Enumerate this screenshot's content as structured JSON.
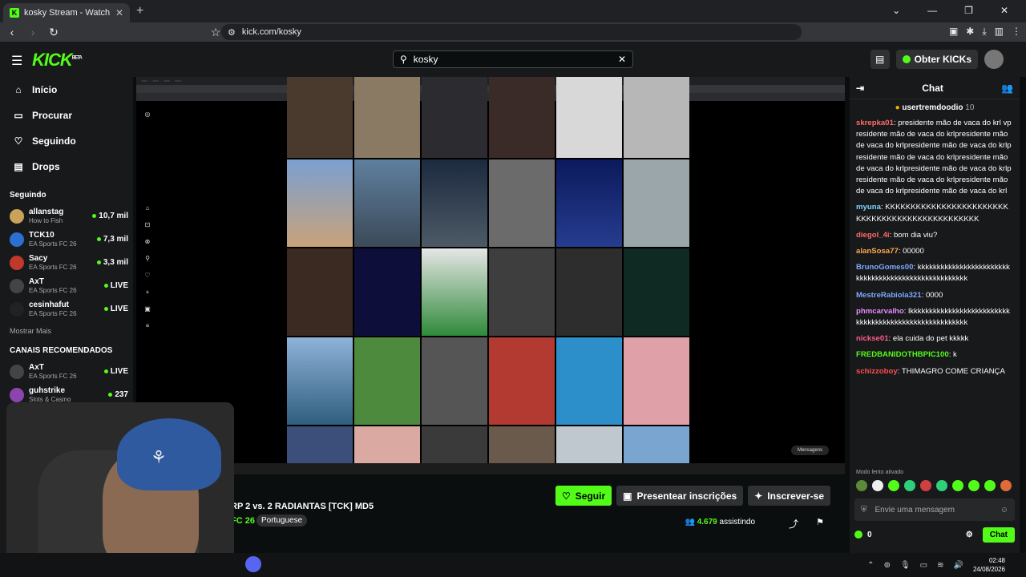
{
  "browser": {
    "tab_title": "kosky Stream - Watch Live on Ki",
    "url": "kick.com/kosky"
  },
  "header": {
    "logo": "KICK",
    "logo_tag": "BETA",
    "search_value": "kosky",
    "kicks_label": "Obter KICKs"
  },
  "sidebar": {
    "nav": [
      {
        "label": "Início",
        "icon": "home-icon"
      },
      {
        "label": "Procurar",
        "icon": "browse-icon"
      },
      {
        "label": "Seguindo",
        "icon": "heart-icon"
      },
      {
        "label": "Drops",
        "icon": "drops-icon"
      }
    ],
    "following_title": "Seguindo",
    "following": [
      {
        "name": "allanstag",
        "category": "How to Fish",
        "viewers": "10,7 mil",
        "color": "#c9a25b"
      },
      {
        "name": "TCK10",
        "category": "EA Sports FC 26",
        "viewers": "7,3 mil",
        "color": "#2c6fd0"
      },
      {
        "name": "Sacy",
        "category": "EA Sports FC 26",
        "viewers": "3,3 mil",
        "color": "#c0392b"
      },
      {
        "name": "AxT",
        "category": "EA Sports FC 26",
        "viewers": "LIVE",
        "color": "#444"
      },
      {
        "name": "cesinhafut",
        "category": "EA Sports FC 26",
        "viewers": "LIVE",
        "color": "#222"
      }
    ],
    "show_more": "Mostrar Mais",
    "recommended_title": "CANAIS RECOMENDADOS",
    "recommended": [
      {
        "name": "AxT",
        "category": "EA Sports FC 26",
        "viewers": "LIVE",
        "color": "#444"
      },
      {
        "name": "guhstrike",
        "category": "Slots & Casino",
        "viewers": "237",
        "color": "#8e44ad"
      }
    ]
  },
  "stream": {
    "title": "RP 2 vs. 2 RADIANTAS [TCK] MD5",
    "category": "FC 26",
    "language": "Portuguese",
    "follow_label": "Seguir",
    "gift_label": "Presentear inscrições",
    "subscribe_label": "Inscrever-se",
    "viewers": "4.679",
    "viewers_suffix": "assistindo"
  },
  "video_overlay": {
    "messages_label": "Mensagens"
  },
  "chat": {
    "title": "Chat",
    "pinned_user": "usertremdoodio",
    "pinned_count": "10",
    "messages": [
      {
        "user": "skrepka01",
        "color": "#ff6b6b",
        "text": "presidente mão de vaca do krl vpresidente mão de vaca do krlpresidente mão de vaca do krlpresidente mão de vaca do krlpresidente mão de vaca do krlpresidente mão de vaca do krlpresidente mão de vaca do krlpresidente mão de vaca do krlpresidente mão de vaca do krlpresidente mão de vaca do krl"
      },
      {
        "user": "myuna",
        "color": "#7fd3ff",
        "text": "KKKKKKKKKKKKKKKKKKKKKKKKKKKKKKKKKKKKKKKKKKKKKKKK"
      },
      {
        "user": "diegol_4i",
        "color": "#ff6b6b",
        "text": "bom dia viu?"
      },
      {
        "user": "alanSosa77",
        "color": "#ffa94d",
        "text": "00000"
      },
      {
        "user": "BrunoGomes00",
        "color": "#7fa8ff",
        "text": "kkkkkkkkkkkkkkkkkkkkkkkkkkkkkkkkkkkkkkkkkkkkkkkkkkkkk"
      },
      {
        "user": "MestreRabiola321",
        "color": "#7fa8ff",
        "text": "0000"
      },
      {
        "user": "phmcarvalho",
        "color": "#e88cff",
        "text": "lkkkkkkkkkkkkkkkkkkkkkkkkkkkkkkkkkkkkkkkkkkkkkkkkkkkkkkk"
      },
      {
        "user": "nickse01",
        "color": "#ff5c8a",
        "text": "ela cuida do pet kkkkk"
      },
      {
        "user": "FREDBANIDOTHBPIC100",
        "color": "#53fc18",
        "text": "k"
      },
      {
        "user": "schizzoboy",
        "color": "#ff4d4d",
        "text": "THIMAGRO COME CRIANÇA"
      }
    ],
    "slow_mode": "Modo lento ativado",
    "input_placeholder": "Envie uma mensagem",
    "points": "0",
    "send_label": "Chat"
  },
  "taskbar": {
    "time": "02:48",
    "date": "24/08/2026"
  }
}
